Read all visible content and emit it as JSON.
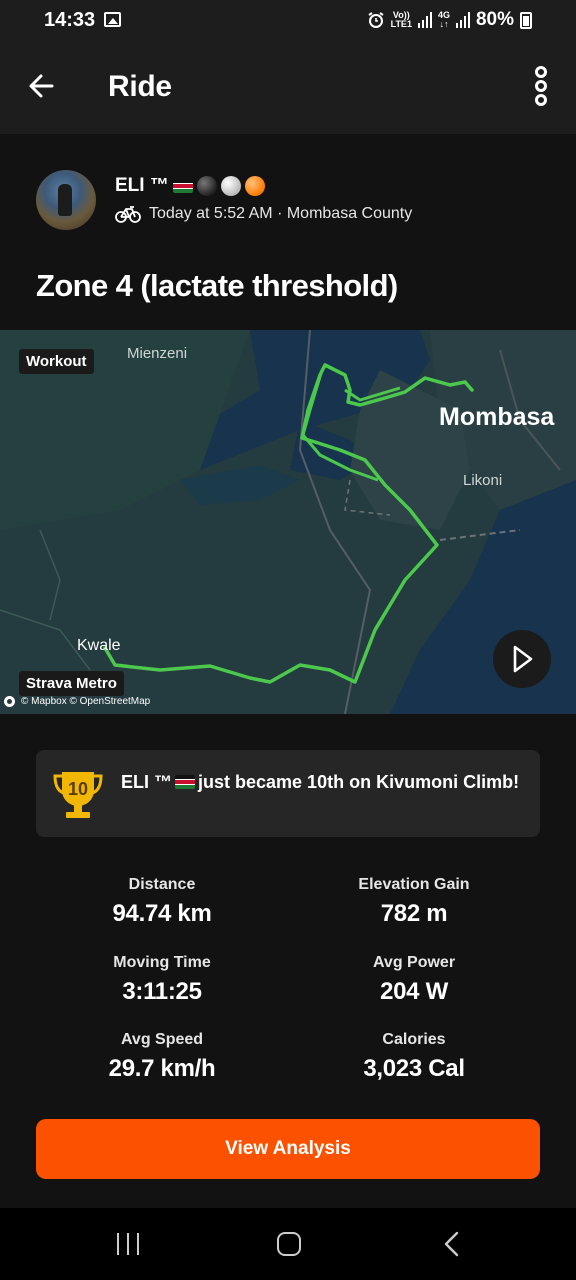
{
  "status_bar": {
    "time": "14:33",
    "net_top": "Vo))",
    "net_bottom": "LTE1",
    "net2_top": "4G",
    "net2_bottom": "↓↑",
    "battery": "80%"
  },
  "app_bar": {
    "title": "Ride"
  },
  "activity": {
    "athlete_name": "ELI ™",
    "meta": "Today at 5:52 AM · Mombasa County",
    "title": "Zone 4 (lactate threshold)"
  },
  "map": {
    "workout_tag": "Workout",
    "metro_tag": "Strava Metro",
    "places": {
      "mienzeni": "Mienzeni",
      "mombasa": "Mombasa",
      "likoni": "Likoni",
      "kwale": "Kwale"
    },
    "attribution": "© Mapbox © OpenStreetMap",
    "route_color": "#4cc94c"
  },
  "achievement": {
    "rank": "10",
    "name": "ELI ™",
    "text": "just became 10th on Kivumoni Climb!"
  },
  "stats": [
    {
      "label": "Distance",
      "value": "94.74 km"
    },
    {
      "label": "Elevation Gain",
      "value": "782 m"
    },
    {
      "label": "Moving Time",
      "value": "3:11:25"
    },
    {
      "label": "Avg Power",
      "value": "204 W"
    },
    {
      "label": "Avg Speed",
      "value": "29.7 km/h"
    },
    {
      "label": "Calories",
      "value": "3,023 Cal"
    }
  ],
  "cta": {
    "label": "View Analysis"
  },
  "colors": {
    "accent": "#fc5200",
    "background": "#121212",
    "card": "#262626"
  }
}
